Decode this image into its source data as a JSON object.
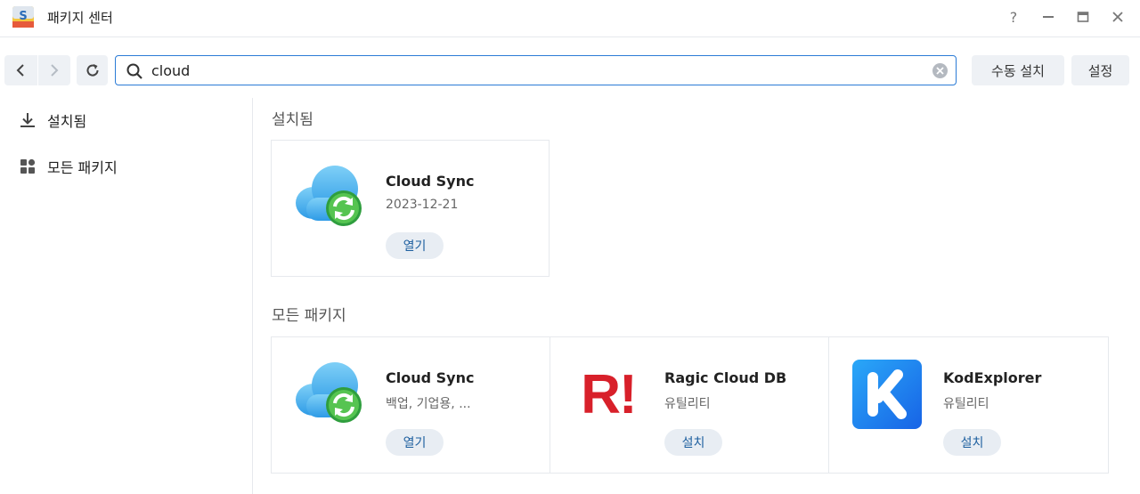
{
  "window": {
    "title": "패키지 센터"
  },
  "toolbar": {
    "search_value": "cloud",
    "manual_install_label": "수동 설치",
    "settings_label": "설정"
  },
  "sidebar": {
    "items": [
      {
        "label": "설치됨",
        "icon": "download-icon"
      },
      {
        "label": "모든 패키지",
        "icon": "grid-icon"
      }
    ]
  },
  "installed": {
    "title": "설치됨",
    "packages": [
      {
        "name": "Cloud Sync",
        "subtitle": "2023-12-21",
        "action": "열기",
        "icon": "cloud-sync-icon"
      }
    ]
  },
  "all": {
    "title": "모든 패키지",
    "packages": [
      {
        "name": "Cloud Sync",
        "subtitle": "백업, 기업용, ...",
        "action": "열기",
        "icon": "cloud-sync-icon"
      },
      {
        "name": "Ragic Cloud DB",
        "subtitle": "유틸리티",
        "action": "설치",
        "icon": "ragic-logo-icon",
        "logo_text": "R!"
      },
      {
        "name": "KodExplorer",
        "subtitle": "유틸리티",
        "action": "설치",
        "icon": "kodexplorer-logo-icon"
      }
    ]
  },
  "colors": {
    "accent": "#2b7bd6",
    "ragic_red": "#d8202a",
    "kod_blue": "#1e7cf0"
  }
}
